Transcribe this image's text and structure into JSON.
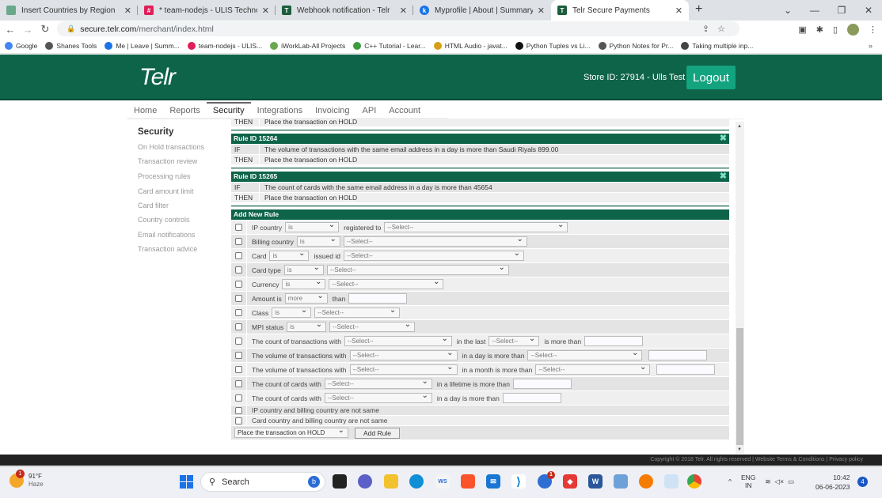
{
  "browser": {
    "tabs": [
      {
        "title": "Insert Countries by Region",
        "icon": "bookstack-icon",
        "color": "#6aa88c"
      },
      {
        "title": "* team-nodejs - ULIS Technology",
        "icon": "slack-icon",
        "color": "#e01e5a"
      },
      {
        "title": "Webhook notification - Telr",
        "icon": "telr-icon",
        "color": "#1b5e3b"
      },
      {
        "title": "Myprofile | About | Summary",
        "icon": "keka-icon",
        "color": "#1a73e8"
      },
      {
        "title": "Telr Secure Payments",
        "icon": "telr-icon",
        "color": "#1b5e3b",
        "active": true
      }
    ],
    "url_host": "secure.telr.com",
    "url_path": "/merchant/index.html",
    "bookmarks": [
      {
        "label": "Google",
        "icon": "google-icon",
        "color": "#4285f4"
      },
      {
        "label": "Shanes Tools",
        "icon": "globe-icon",
        "color": "#555"
      },
      {
        "label": "Me | Leave | Summ...",
        "icon": "keka-icon",
        "color": "#1a73e8"
      },
      {
        "label": "team-nodejs - ULIS...",
        "icon": "slack-icon",
        "color": "#e01e5a"
      },
      {
        "label": "iWorkLab-All Projects",
        "icon": "check-icon",
        "color": "#6aa84f"
      },
      {
        "label": "C++ Tutorial - Lear...",
        "icon": "b-icon",
        "color": "#3d9c3d"
      },
      {
        "label": "HTML Audio - javat...",
        "icon": "javatpoint-icon",
        "color": "#d4a017"
      },
      {
        "label": "Python Tuples vs Li...",
        "icon": "dev-icon",
        "color": "#111"
      },
      {
        "label": "Python Notes for Pr...",
        "icon": "globe-icon",
        "color": "#555"
      },
      {
        "label": "Taking multiple inp...",
        "icon": "doc-icon",
        "color": "#444"
      }
    ]
  },
  "header": {
    "logo": "Telr",
    "store": "Store ID: 27914 - Ulls Test",
    "logout": "Logout"
  },
  "menu": [
    "Home",
    "Reports",
    "Security",
    "Integrations",
    "Invoicing",
    "API",
    "Account"
  ],
  "menu_active": "Security",
  "sidebar": {
    "title": "Security",
    "items": [
      "On Hold transactions",
      "Transaction review",
      "Processing rules",
      "Card amount limit",
      "Card filter",
      "Country controls",
      "Email notifications",
      "Transaction advice"
    ]
  },
  "rules": {
    "truncated_then": {
      "k": "THEN",
      "v": "Place the transaction on HOLD"
    },
    "list": [
      {
        "title": "Rule ID 15264",
        "if_label": "IF",
        "if_text": "The volume of transactions with the same email address in a day is more than Saudi Riyals 899.00",
        "then_label": "THEN",
        "then_text": "Place the transaction on HOLD"
      },
      {
        "title": "Rule ID 15265",
        "if_label": "IF",
        "if_text": "The count of cards with the same email address in a day is more than 45654",
        "then_label": "THEN",
        "then_text": "Place the transaction on HOLD"
      }
    ]
  },
  "add_rule": {
    "title": "Add New Rule",
    "select_placeholder": "--Select--",
    "rows": {
      "ip_country": {
        "label": "IP country",
        "op": "is",
        "mid": "registered to"
      },
      "billing_country": {
        "label": "Billing country",
        "op": "is"
      },
      "card": {
        "label": "Card",
        "op": "is",
        "mid": "issued id"
      },
      "card_type": {
        "label": "Card type",
        "op": "is"
      },
      "currency": {
        "label": "Currency",
        "op": "is"
      },
      "amount": {
        "label": "Amount is",
        "op": "more",
        "mid": "than"
      },
      "class": {
        "label": "Class",
        "op": "is"
      },
      "mpi": {
        "label": "MPI status",
        "op": "is"
      },
      "count_tx": {
        "label": "The count of transactions with",
        "mid": "in the last",
        "end": "is more than"
      },
      "vol_day": {
        "label": "The volume of transactions with",
        "mid": "in a day is more than"
      },
      "vol_month": {
        "label": "The volume of transactions with",
        "mid": "in a month is more than"
      },
      "cards_life": {
        "label": "The count of cards with",
        "mid": "in a lifetime is more than"
      },
      "cards_day": {
        "label": "The count of cards with",
        "mid": "in a day is more than"
      },
      "ip_billing": {
        "label": "IP country and billing country are not same"
      },
      "card_billing": {
        "label": "Card country and billing country are not same"
      }
    },
    "action": "Place the transaction on HOLD",
    "add_button": "Add Rule"
  },
  "footer": "Copyright © 2018 Telr. All rights reserved | Website Terms & Conditions | Privacy policy",
  "taskbar": {
    "weather_temp": "91°F",
    "weather_desc": "Haze",
    "weather_badge": "1",
    "search": "Search",
    "lang_top": "ENG",
    "lang_bottom": "IN",
    "time": "10:42",
    "date": "06-06-2023",
    "notifications": "4",
    "thunderbird_badge": "1"
  }
}
